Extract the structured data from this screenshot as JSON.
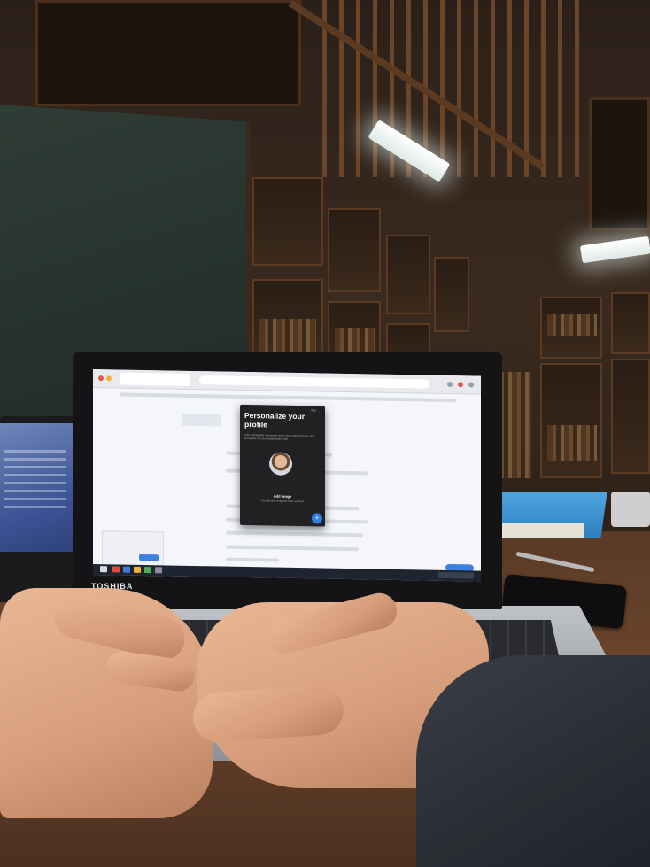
{
  "photo": {
    "laptop_brand": "TOSHIBA"
  },
  "screen": {
    "modal": {
      "title": "Personalize your profile",
      "skip_label": "Skip",
      "description": "Add a photo that represents you to help others find you and know who they are collaborating with.",
      "avatar_caption": "",
      "add_image_label": "Add image",
      "add_image_sub": "You can also drag and drop a picture",
      "fab_icon": "+"
    }
  },
  "colors": {
    "modal_bg": "#212124",
    "accent": "#2f7fe6",
    "screen_bg": "#f4f6fb"
  }
}
